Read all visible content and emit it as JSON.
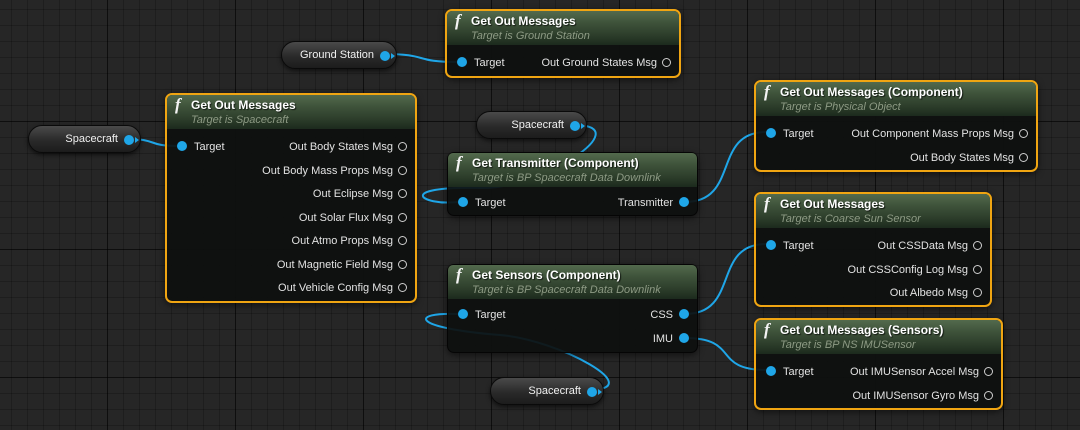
{
  "pins": {
    "target": "Target",
    "transmitter": "Transmitter",
    "css": "CSS",
    "imu": "IMU"
  },
  "variables": {
    "ground_station": "Ground Station",
    "spacecraft": "Spacecraft"
  },
  "nodes": {
    "gm_ground": {
      "title": "Get Out Messages",
      "subtitle": "Target is Ground Station",
      "outputs": [
        "Out Ground States Msg"
      ]
    },
    "gm_spacecraft": {
      "title": "Get Out Messages",
      "subtitle": "Target is Spacecraft",
      "outputs": [
        "Out Body States Msg",
        "Out Body Mass Props Msg",
        "Out Eclipse Msg",
        "Out Solar Flux Msg",
        "Out Atmo Props Msg",
        "Out Magnetic Field Msg",
        "Out Vehicle Config Msg"
      ]
    },
    "get_transmitter": {
      "title": "Get Transmitter (Component)",
      "subtitle": "Target is BP Spacecraft Data Downlink"
    },
    "get_sensors": {
      "title": "Get Sensors (Component)",
      "subtitle": "Target is BP Spacecraft Data Downlink"
    },
    "gm_component": {
      "title": "Get Out Messages (Component)",
      "subtitle": "Target is Physical Object",
      "outputs": [
        "Out Component Mass Props Msg",
        "Out Body States Msg"
      ]
    },
    "gm_css": {
      "title": "Get Out Messages",
      "subtitle": "Target is Coarse Sun Sensor",
      "outputs": [
        "Out CSSData Msg",
        "Out CSSConfig Log Msg",
        "Out Albedo Msg"
      ]
    },
    "gm_sensors": {
      "title": "Get Out Messages (Sensors)",
      "subtitle": "Target is BP NS IMUSensor",
      "outputs": [
        "Out IMUSensor Accel Msg",
        "Out IMUSensor Gyro Msg"
      ]
    }
  },
  "colors": {
    "background": "#262626",
    "wire": "#1fa6e8",
    "selection_border": "#f0a512",
    "function_header": "#3e523a",
    "object_pin": "#1fa6e8"
  }
}
